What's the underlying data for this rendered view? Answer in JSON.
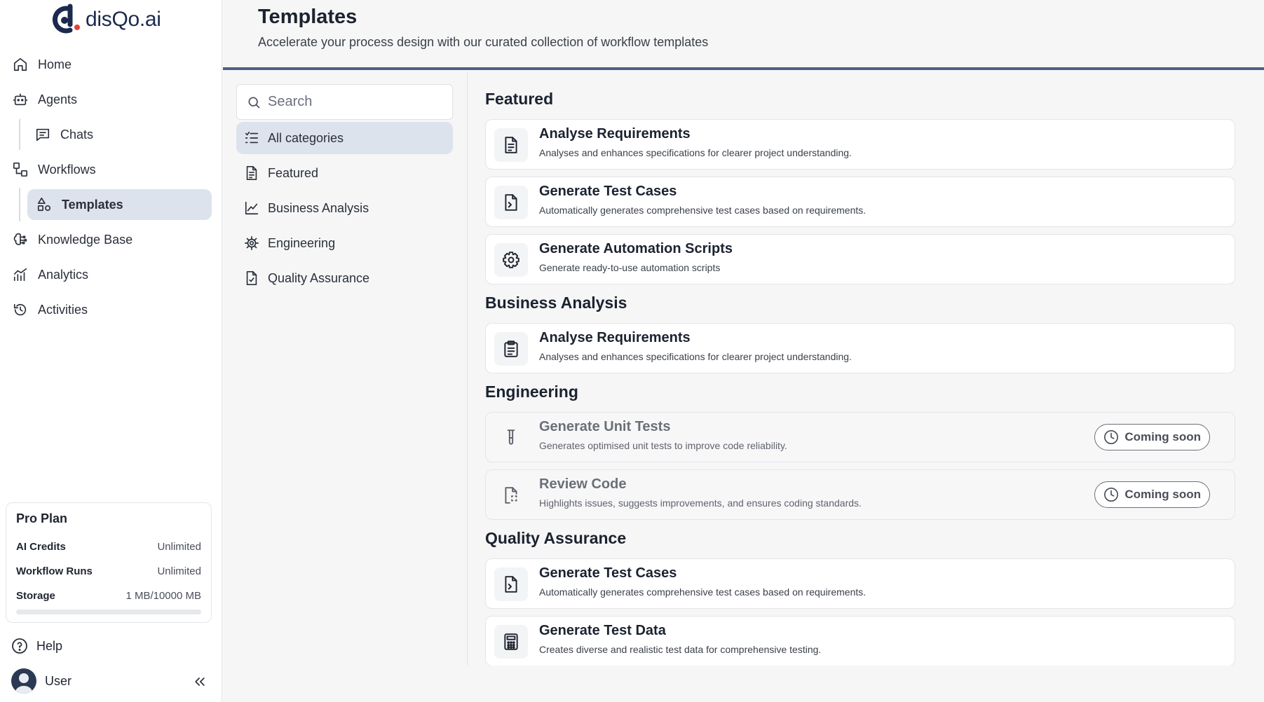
{
  "brand": {
    "name": "disQo.ai",
    "accent": "#1b2a4e",
    "dot_color": "#e0433a"
  },
  "sidebar": {
    "items": [
      {
        "label": "Home",
        "icon": "home-icon"
      },
      {
        "label": "Agents",
        "icon": "agent-icon"
      },
      {
        "label": "Chats",
        "icon": "chat-icon"
      },
      {
        "label": "Workflows",
        "icon": "workflow-icon"
      },
      {
        "label": "Templates",
        "icon": "shapes-icon"
      },
      {
        "label": "Knowledge Base",
        "icon": "brain-icon"
      },
      {
        "label": "Analytics",
        "icon": "chart-icon"
      },
      {
        "label": "Activities",
        "icon": "history-icon"
      }
    ],
    "active": "Templates",
    "plan": {
      "title": "Pro Plan",
      "rows": [
        {
          "key": "AI Credits",
          "value": "Unlimited"
        },
        {
          "key": "Workflow Runs",
          "value": "Unlimited"
        },
        {
          "key": "Storage",
          "value": "1 MB/10000 MB"
        }
      ],
      "storage_fraction": 0.0001
    },
    "help": "Help",
    "user": "User"
  },
  "header": {
    "title": "Templates",
    "subtitle": "Accelerate your process design with our curated collection of workflow templates"
  },
  "categories": {
    "search_placeholder": "Search",
    "items": [
      {
        "label": "All categories",
        "icon": "list-icon"
      },
      {
        "label": "Featured",
        "icon": "document-icon"
      },
      {
        "label": "Business Analysis",
        "icon": "line-chart-icon"
      },
      {
        "label": "Engineering",
        "icon": "cog-icon"
      },
      {
        "label": "Quality Assurance",
        "icon": "file-check-icon"
      }
    ],
    "active": "All categories"
  },
  "sections": [
    {
      "title": "Featured",
      "cards": [
        {
          "title": "Analyse Requirements",
          "desc": "Analyses and enhances specifications for clearer project understanding.",
          "icon": "document-icon"
        },
        {
          "title": "Generate Test Cases",
          "desc": "Automatically generates comprehensive test cases based on requirements.",
          "icon": "file-terminal-icon"
        },
        {
          "title": "Generate Automation Scripts",
          "desc": "Generate ready-to-use automation scripts",
          "icon": "gear-icon"
        }
      ]
    },
    {
      "title": "Business Analysis",
      "cards": [
        {
          "title": "Analyse Requirements",
          "desc": "Analyses and enhances specifications for clearer project understanding.",
          "icon": "clipboard-icon"
        }
      ]
    },
    {
      "title": "Engineering",
      "cards": [
        {
          "title": "Generate Unit Tests",
          "desc": "Generates optimised unit tests to improve code reliability.",
          "icon": "test-tube-icon",
          "badge": "Coming soon"
        },
        {
          "title": "Review Code",
          "desc": "Highlights issues, suggests improvements, and ensures coding standards.",
          "icon": "file-scan-icon",
          "badge": "Coming soon"
        }
      ]
    },
    {
      "title": "Quality Assurance",
      "cards": [
        {
          "title": "Generate Test Cases",
          "desc": "Automatically generates comprehensive test cases based on requirements.",
          "icon": "file-terminal-icon"
        },
        {
          "title": "Generate Test Data",
          "desc": "Creates diverse and realistic test data for comprehensive testing.",
          "icon": "calculator-icon"
        }
      ]
    }
  ]
}
